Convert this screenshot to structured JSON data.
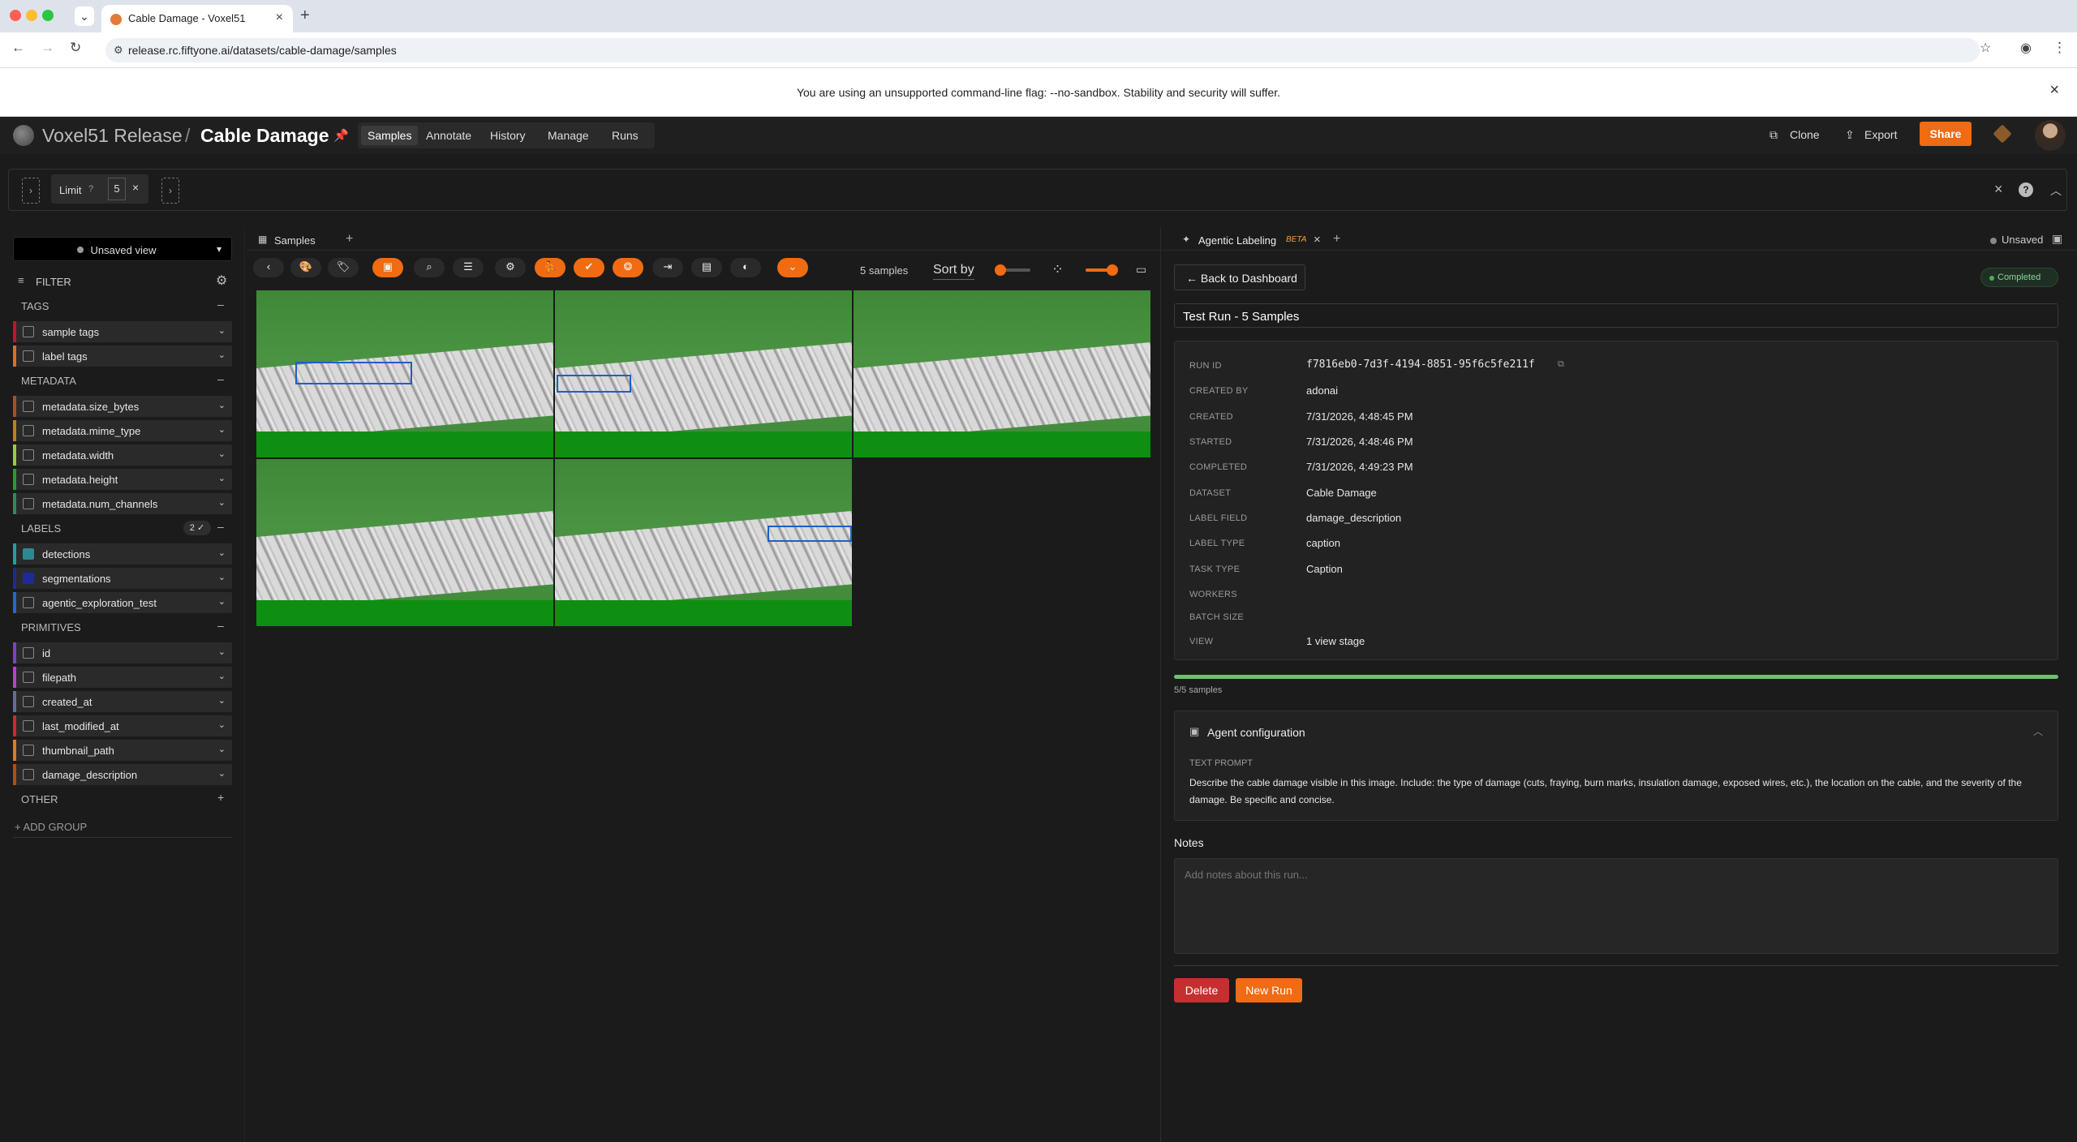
{
  "browser": {
    "tab_title": "Cable Damage - Voxel51",
    "url": "release.rc.fiftyone.ai/datasets/cable-damage/samples",
    "warning": "You are using an unsupported command-line flag: --no-sandbox. Stability and security will suffer."
  },
  "header": {
    "brand": "Voxel51 Release",
    "separator": "/",
    "dataset": "Cable Damage",
    "tabs": [
      "Samples",
      "Annotate",
      "History",
      "Manage",
      "Runs"
    ],
    "clone": "Clone",
    "export": "Export",
    "share": "Share"
  },
  "viewbar": {
    "limit_label": "Limit",
    "limit_value": "5"
  },
  "sidebar": {
    "view": "Unsaved view",
    "filter": "FILTER",
    "sections": {
      "tags": "TAGS",
      "metadata": "METADATA",
      "labels": "LABELS",
      "labels_count": "2",
      "primitives": "PRIMITIVES",
      "other": "OTHER"
    },
    "fields": [
      "sample tags",
      "label tags",
      "metadata.size_bytes",
      "metadata.mime_type",
      "metadata.width",
      "metadata.height",
      "metadata.num_channels",
      "detections",
      "segmentations",
      "agentic_exploration_test",
      "id",
      "filepath",
      "created_at",
      "last_modified_at",
      "thumbnail_path",
      "damage_description"
    ],
    "add_group": "+ ADD GROUP"
  },
  "grid": {
    "tab": "Samples",
    "count": "5 samples",
    "sort": "Sort by"
  },
  "panel": {
    "tab": "Agentic Labeling",
    "beta": "BETA",
    "unsaved": "Unsaved",
    "back": "← Back to Dashboard",
    "status": "Completed",
    "run_name": "Test Run - 5 Samples",
    "details": [
      {
        "k": "RUN ID",
        "v": "f7816eb0-7d3f-4194-8851-95f6c5fe211f"
      },
      {
        "k": "CREATED BY",
        "v": "adonai"
      },
      {
        "k": "CREATED",
        "v": "7/31/2026, 4:48:45 PM"
      },
      {
        "k": "STARTED",
        "v": "7/31/2026, 4:48:46 PM"
      },
      {
        "k": "COMPLETED",
        "v": "7/31/2026, 4:49:23 PM"
      },
      {
        "k": "DATASET",
        "v": "Cable Damage"
      },
      {
        "k": "LABEL FIELD",
        "v": "damage_description"
      },
      {
        "k": "LABEL TYPE",
        "v": "caption"
      },
      {
        "k": "TASK TYPE",
        "v": "Caption"
      },
      {
        "k": "WORKERS",
        "v": ""
      },
      {
        "k": "BATCH SIZE",
        "v": ""
      },
      {
        "k": "VIEW",
        "v": "1 view stage"
      }
    ],
    "progress_label": "5/5 samples",
    "progress": 1.0,
    "agent_title": "Agent configuration",
    "prompt_label": "TEXT PROMPT",
    "prompt": "Describe the cable damage visible in this image. Include: the type of damage (cuts, fraying, burn marks, insulation damage, exposed wires, etc.), the location on the cable, and the severity of the damage. Be specific and concise.",
    "notes_label": "Notes",
    "notes_placeholder": "Add notes about this run...",
    "delete": "Delete",
    "new_run": "New Run"
  }
}
